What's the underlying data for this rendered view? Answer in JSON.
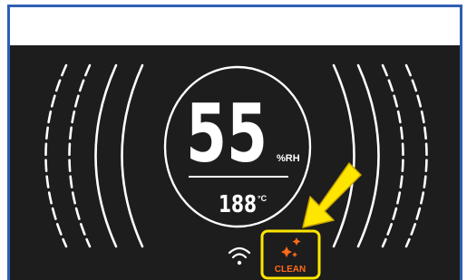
{
  "display": {
    "humidity_value": "55",
    "humidity_unit": "%RH",
    "temperature_value": "188",
    "temperature_unit": "°C",
    "clean_label": "CLEAN"
  },
  "colors": {
    "panel_background": "#1d1d1d",
    "segment_color": "#ffffff",
    "clean_indicator_color": "#ff6a1a",
    "highlight_color": "#ffe600",
    "frame_border": "#2f5fb5"
  },
  "icons": {
    "wifi": "wifi-icon",
    "sparkle": "sparkle-icon",
    "arrow": "arrow-down-left-icon"
  }
}
